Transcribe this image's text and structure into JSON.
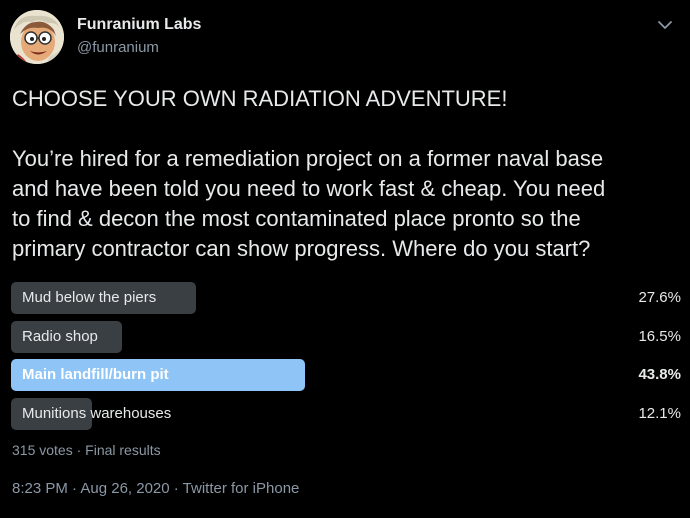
{
  "author": {
    "display_name": "Funranium Labs",
    "handle": "@funranium",
    "avatar_icon": "cartoon-scientist-avatar"
  },
  "tweet": {
    "headline": "CHOOSE YOUR OWN RADIATION ADVENTURE!",
    "body_lines": [
      "You’re hired for a remediation project on a former naval base",
      "and have been told you need to work fast & cheap. You need",
      "to find & decon the most contaminated place pronto so the",
      "primary contractor can show progress. Where do you start?"
    ]
  },
  "poll": {
    "options": [
      {
        "label": "Mud below the piers",
        "percent_text": "27.6%",
        "percent": 27.6,
        "winner": false
      },
      {
        "label": "Radio shop",
        "percent_text": "16.5%",
        "percent": 16.5,
        "winner": false
      },
      {
        "label": "Main landfill/burn pit",
        "percent_text": "43.8%",
        "percent": 43.8,
        "winner": true
      },
      {
        "label": "Munitions warehouses",
        "percent_text": "12.1%",
        "percent": 12.1,
        "winner": false
      }
    ],
    "summary": "315 votes · Final results"
  },
  "meta": {
    "timestamp": "8:23 PM · Aug 26, 2020 · Twitter for iPhone"
  },
  "colors": {
    "background": "#000000",
    "bar_default": "#3a3f44",
    "bar_winner": "#8ec4f6",
    "muted_text": "#8b98a5"
  }
}
